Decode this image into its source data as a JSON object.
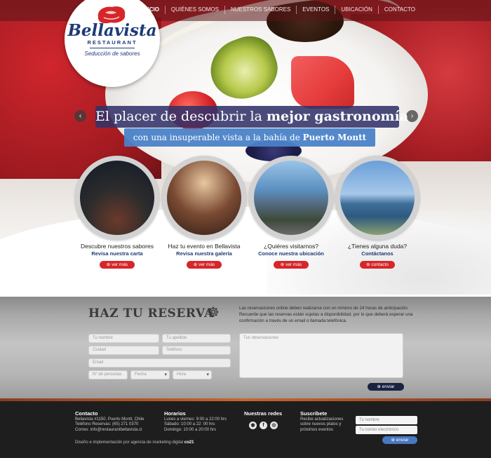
{
  "nav": {
    "items": [
      {
        "label": "INICIO"
      },
      {
        "label": "QUIÉNES SOMOS"
      },
      {
        "label": "NUESTROS SABORES"
      },
      {
        "label": "EVENTOS"
      },
      {
        "label": "UBICACIÓN"
      },
      {
        "label": "CONTACTO"
      }
    ]
  },
  "logo": {
    "name": "Bellavista",
    "sub": "RESTAURANT",
    "tagline": "Seducción de sabores"
  },
  "slider": {
    "headline_part1": "El placer de descubrir la ",
    "headline_bold": "mejor gastronomía",
    "subline_part1": "con una insuperable vista a la bahía de ",
    "subline_bold": "Puerto Montt",
    "prev_icon": "chevron-left-icon",
    "next_icon": "chevron-right-icon"
  },
  "cards": [
    {
      "title": "Descubre nuestros sabores",
      "link": "Revisa nuestra carta",
      "button": "ver más"
    },
    {
      "title": "Haz tu evento en Bellavista",
      "link": "Revisa nuestra galería",
      "button": "ver más"
    },
    {
      "title": "¿Quiéres visitarnos?",
      "link": "Conoce nuestra ubicación",
      "button": "ver más"
    },
    {
      "title": "¿Tienes alguna duda?",
      "link": "Contáctanos",
      "button": "contacto"
    }
  ],
  "reserva": {
    "title": "HAZ TU RESERVA",
    "text": "Las reservaciones online deben realizarse con un mínimo de 24 horas de anticipación. Recuerde que las reservas están sujetas a disponibilidad, por lo que deberá esperar una confirmación a través de un email o llamada telefónica.",
    "fields": {
      "nombre": "Tu nombre",
      "apellido": "Tu apellido",
      "ciudad": "Ciudad",
      "telefono": "Teléfono",
      "email": "Email",
      "personas": "N° de personas",
      "fecha": "Fecha",
      "hora": "Hora",
      "observaciones": "Tus observaciones"
    },
    "button": "enviar"
  },
  "footer": {
    "contacto": {
      "title": "Contacto",
      "line1": "Bellavista #1150, Puerto Montt, Chile",
      "line2": "Teléfono Reservas: (65) 271 0370",
      "line3": "Correo: info@restaurantbellavista.cl"
    },
    "horarios": {
      "title": "Horarios",
      "line1": "Lunes a viernes: 9:00 a 22:00 hrs",
      "line2": "Sábado: 10:00 a 22: 00 hrs",
      "line3": "Domingo: 10:00 a 20:00 hrs"
    },
    "redes": {
      "title": "Nuestras redes",
      "icons": [
        "tripadvisor-icon",
        "facebook-icon",
        "instagram-icon"
      ]
    },
    "suscribete": {
      "title": "Suscribete",
      "line1": "Recibe actualizaciones",
      "line2": "sobre nuevos platos y",
      "line3": "próximos eventos",
      "nombre": "Tu nombre",
      "correo": "Tu correo electrónico",
      "button": "enviar"
    },
    "credit_prefix": "Diseño e implementación por agencia de marketing digital ",
    "credit_brand": "co21"
  },
  "colors": {
    "brand_blue": "#1d3a78",
    "accent_red": "#d6262a",
    "footer_bg": "#1e1e1e"
  }
}
